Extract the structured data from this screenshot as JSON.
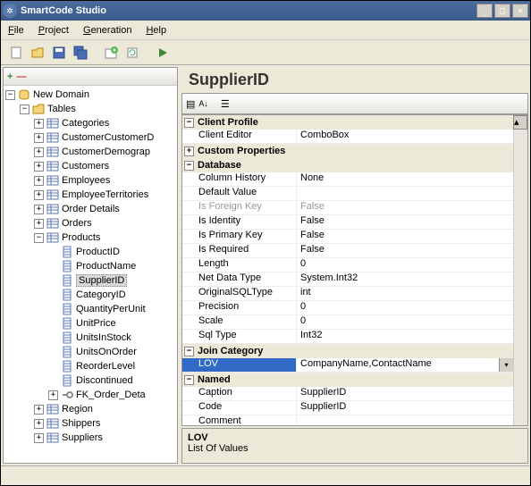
{
  "window": {
    "title": "SmartCode Studio"
  },
  "menu": {
    "file": "File",
    "project": "Project",
    "generation": "Generation",
    "help": "Help"
  },
  "tree": {
    "root": "New Domain",
    "tables": "Tables",
    "items": [
      "Categories",
      "CustomerCustomerD",
      "CustomerDemograp",
      "Customers",
      "Employees",
      "EmployeeTerritories",
      "Order Details",
      "Orders"
    ],
    "products": "Products",
    "product_cols": [
      "ProductID",
      "ProductName",
      "SupplierID",
      "CategoryID",
      "QuantityPerUnit",
      "UnitPrice",
      "UnitsInStock",
      "UnitsOnOrder",
      "ReorderLevel",
      "Discontinued",
      "FK_Order_Deta"
    ],
    "bottom": [
      "Region",
      "Shippers",
      "Suppliers"
    ],
    "selected": "SupplierID"
  },
  "header": {
    "title": "SupplierID"
  },
  "props": {
    "cat_client": "Client Profile",
    "client_editor_k": "Client Editor",
    "client_editor_v": "ComboBox",
    "cat_custom": "Custom Properties",
    "cat_db": "Database",
    "col_history_k": "Column History",
    "col_history_v": "None",
    "default_k": "Default Value",
    "default_v": "",
    "fk_k": "Is Foreign Key",
    "fk_v": "False",
    "identity_k": "Is Identity",
    "identity_v": "False",
    "pk_k": "Is Primary Key",
    "pk_v": "False",
    "req_k": "Is Required",
    "req_v": "False",
    "len_k": "Length",
    "len_v": "0",
    "netdt_k": "Net Data Type",
    "netdt_v": "System.Int32",
    "osql_k": "OriginalSQLType",
    "osql_v": "int",
    "prec_k": "Precision",
    "prec_v": "0",
    "scale_k": "Scale",
    "scale_v": "0",
    "sqlt_k": "Sql Type",
    "sqlt_v": "Int32",
    "cat_join": "Join Category",
    "lov_k": "LOV",
    "lov_v": "CompanyName,ContactName",
    "cat_named": "Named",
    "caption_k": "Caption",
    "caption_v": "SupplierID",
    "code_k": "Code",
    "code_v": "SupplierID",
    "comment_k": "Comment",
    "comment_v": ""
  },
  "desc": {
    "title": "LOV",
    "body": "List Of Values"
  },
  "chart_data": {
    "type": "table",
    "title": "SupplierID column properties",
    "rows": [
      {
        "property": "Client Editor",
        "value": "ComboBox"
      },
      {
        "property": "Column History",
        "value": "None"
      },
      {
        "property": "Default Value",
        "value": ""
      },
      {
        "property": "Is Foreign Key",
        "value": "False"
      },
      {
        "property": "Is Identity",
        "value": "False"
      },
      {
        "property": "Is Primary Key",
        "value": "False"
      },
      {
        "property": "Is Required",
        "value": "False"
      },
      {
        "property": "Length",
        "value": 0
      },
      {
        "property": "Net Data Type",
        "value": "System.Int32"
      },
      {
        "property": "OriginalSQLType",
        "value": "int"
      },
      {
        "property": "Precision",
        "value": 0
      },
      {
        "property": "Scale",
        "value": 0
      },
      {
        "property": "Sql Type",
        "value": "Int32"
      },
      {
        "property": "LOV",
        "value": "CompanyName,ContactName"
      },
      {
        "property": "Caption",
        "value": "SupplierID"
      },
      {
        "property": "Code",
        "value": "SupplierID"
      },
      {
        "property": "Comment",
        "value": ""
      }
    ]
  }
}
